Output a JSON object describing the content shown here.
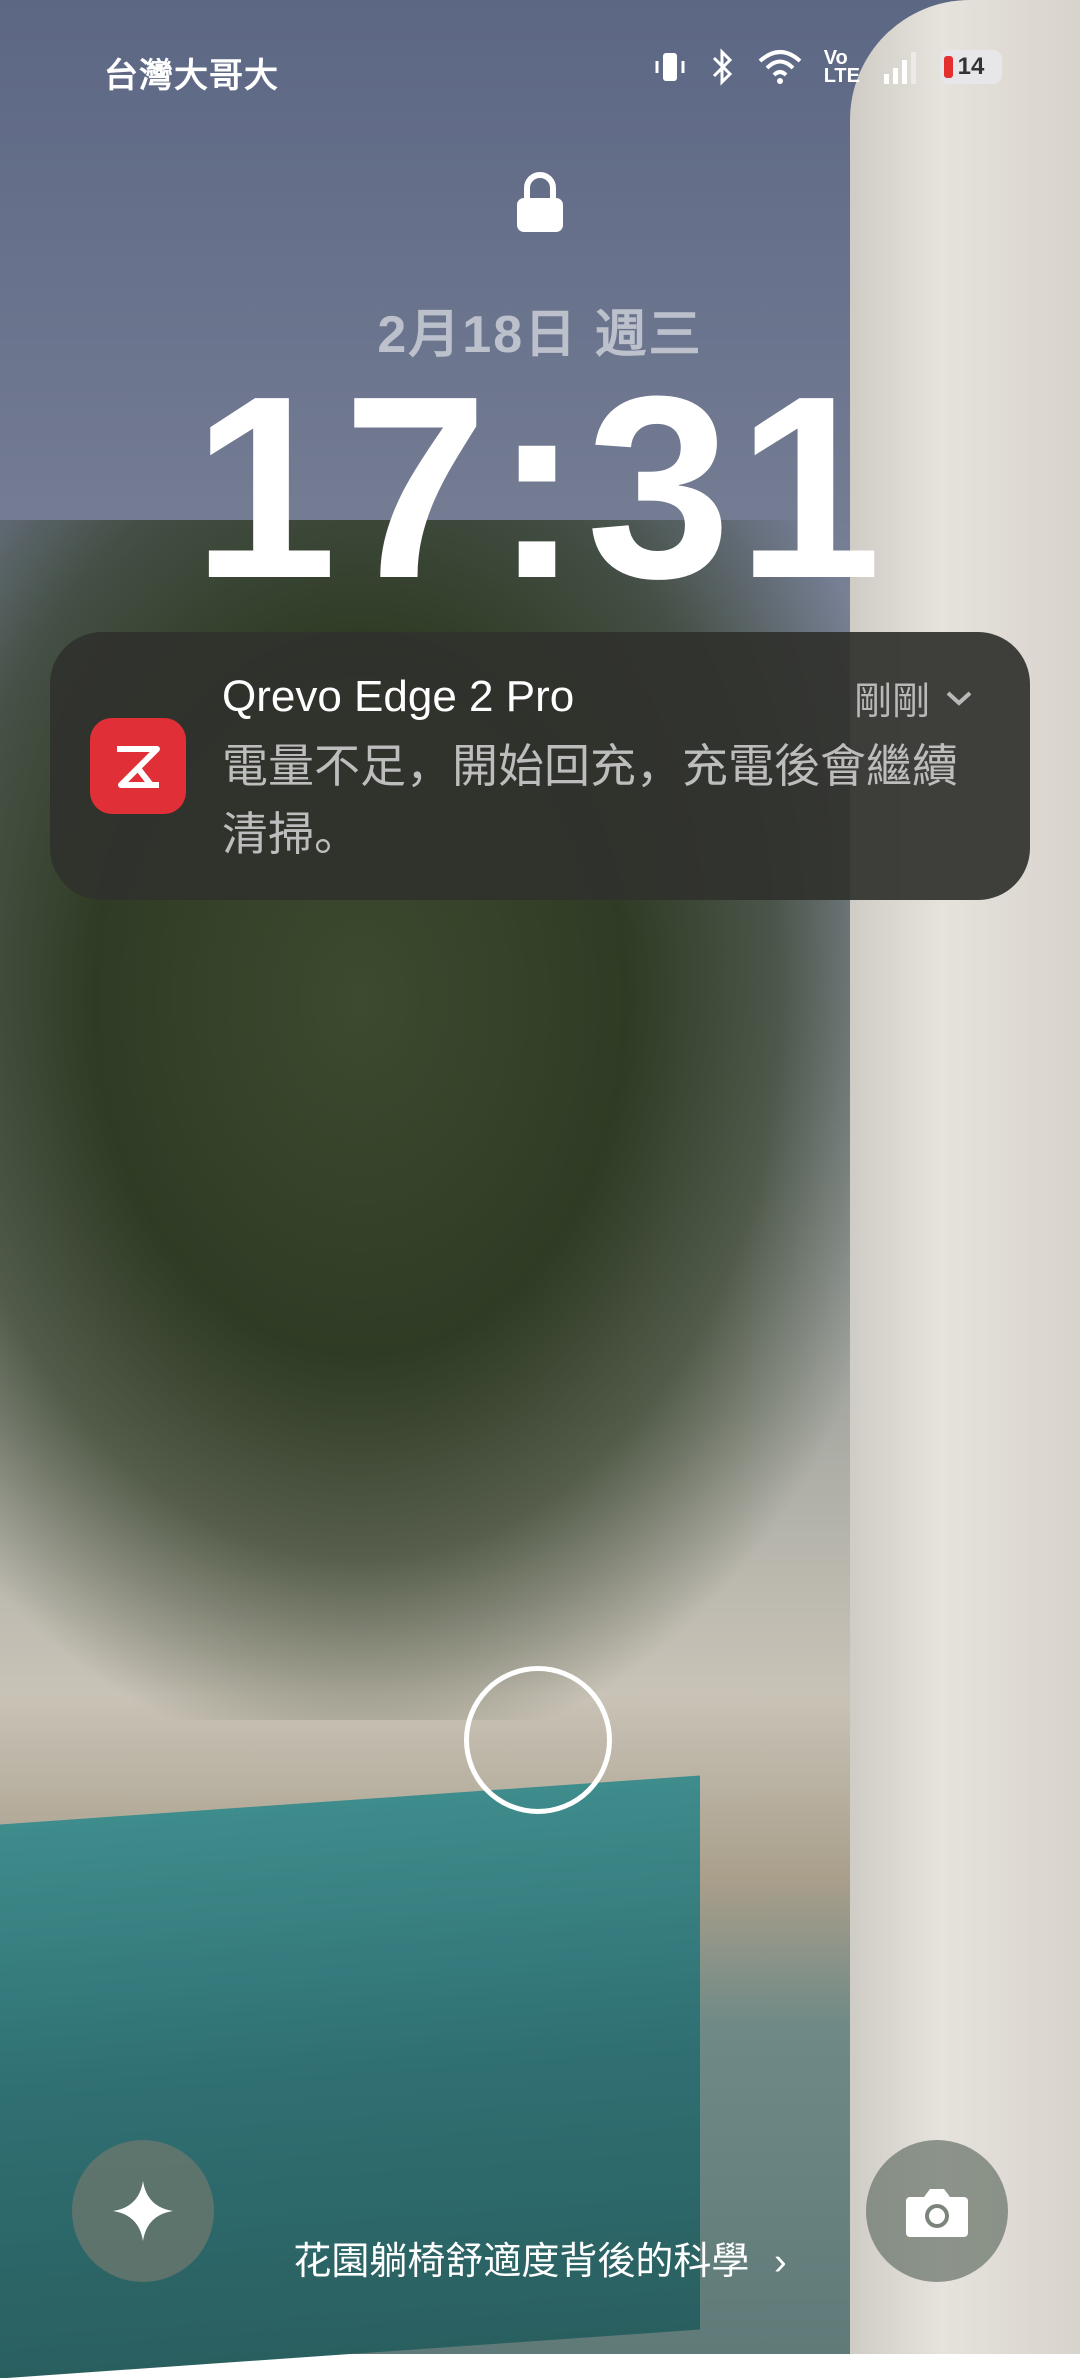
{
  "status_bar": {
    "carrier": "台灣大哥大",
    "volte": "Vo\nLTE",
    "battery_level": "14"
  },
  "lockscreen": {
    "date": "2月18日 週三",
    "time": "17:31"
  },
  "notification": {
    "app_title": "Qrevo Edge 2 Pro",
    "timestamp": "剛剛",
    "message": "電量不足，開始回充，充電後會繼續清掃。"
  },
  "bottom": {
    "caption": "花園躺椅舒適度背後的科學",
    "caption_chevron": "›"
  },
  "icons": {
    "lock": "lock-icon",
    "vibrate": "vibrate-icon",
    "bluetooth": "bluetooth-icon",
    "wifi": "wifi-icon",
    "signal": "signal-icon",
    "fingerprint": "fingerprint-ring-icon",
    "assistant": "sparkle-icon",
    "camera": "camera-icon"
  },
  "colors": {
    "notification_bg": "#30312c",
    "app_icon_bg": "#e02f36",
    "battery_low": "#e4312f"
  }
}
